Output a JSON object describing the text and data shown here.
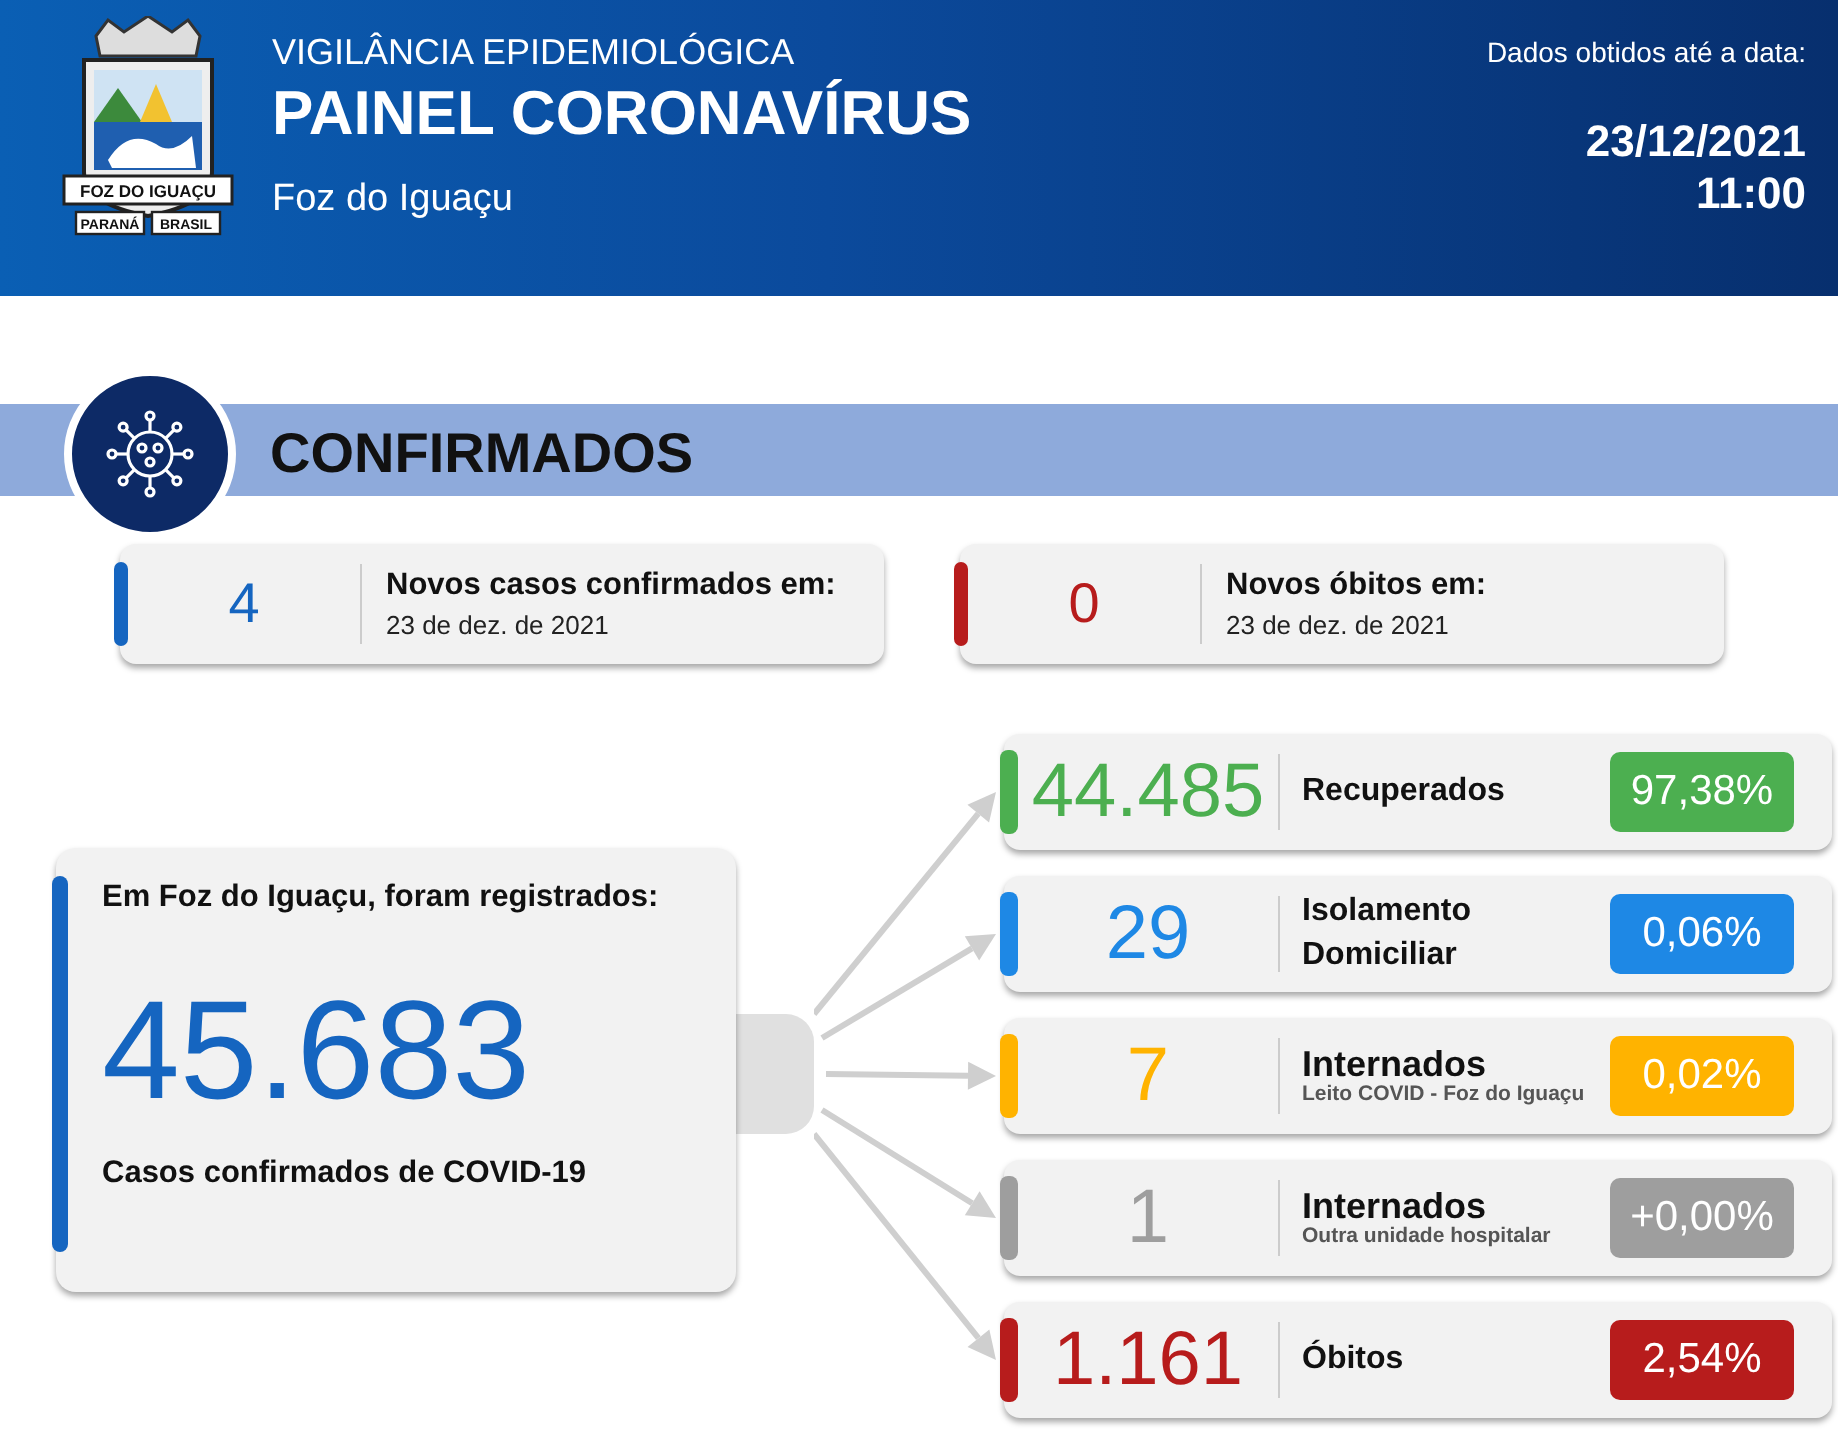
{
  "header": {
    "kicker": "VIGILÂNCIA EPIDEMIOLÓGICA",
    "title": "PAINEL CORONAVÍRUS",
    "city": "Foz do Iguaçu",
    "date_label": "Dados obtidos até a data:",
    "date": "23/12/2021",
    "time": "11:00",
    "logo_texts": [
      "FOZ DO IGUAÇU",
      "PARANÁ",
      "BRASIL"
    ]
  },
  "section": {
    "title": "CONFIRMADOS"
  },
  "new_cards": [
    {
      "value": "4",
      "title": "Novos casos confirmados em:",
      "date": "23 de dez. de 2021",
      "color": "#1565c0"
    },
    {
      "value": "0",
      "title": "Novos óbitos em:",
      "date": "23 de dez. de 2021",
      "color": "#b71c1c"
    }
  ],
  "total": {
    "intro": "Em Foz do Iguaçu, foram registrados:",
    "value": "45.683",
    "caption": "Casos confirmados de COVID-19",
    "color": "#1565c0"
  },
  "breakdown": [
    {
      "value": "44.485",
      "label": "Recuperados",
      "percent": "97,38%",
      "color": "#4caf50"
    },
    {
      "value": "29",
      "label": "Isolamento Domiciliar",
      "percent": "0,06%",
      "color": "#1e88e5"
    },
    {
      "value": "7",
      "label": "Internados",
      "sublabel": "Leito COVID - Foz do Iguaçu",
      "percent": "0,02%",
      "color": "#ffb300"
    },
    {
      "value": "1",
      "label": "Internados",
      "sublabel": "Outra unidade hospitalar",
      "percent": "+0,00%",
      "color": "#9e9e9e"
    },
    {
      "value": "1.161",
      "label": "Óbitos",
      "percent": "2,54%",
      "color": "#b71c1c"
    }
  ]
}
